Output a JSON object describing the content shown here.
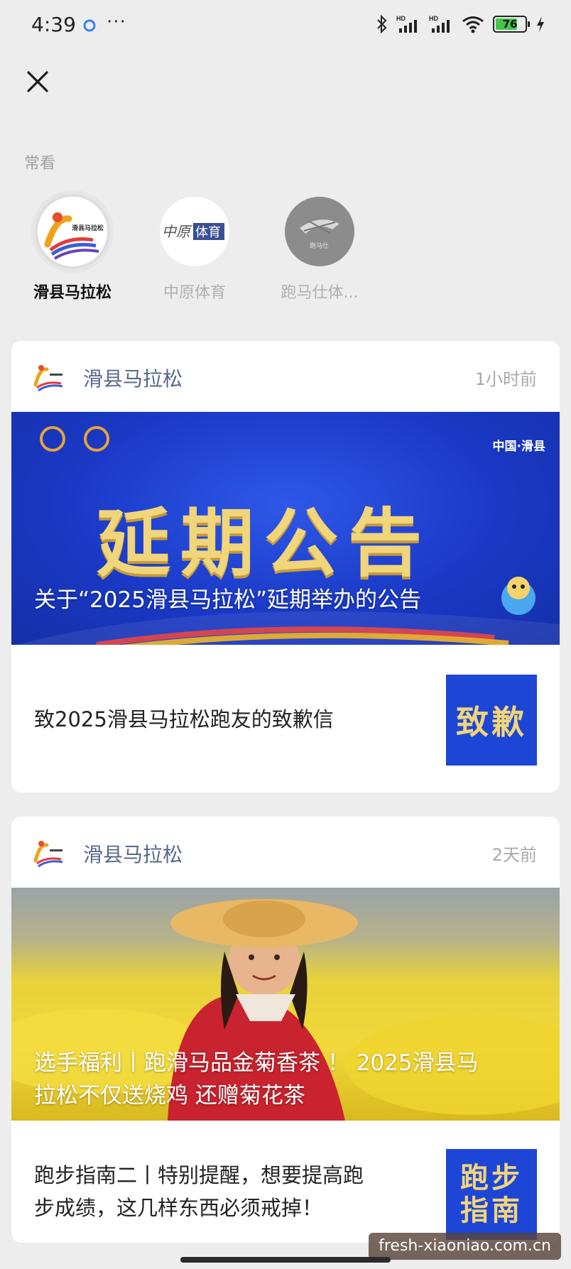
{
  "status_bar": {
    "time": "4:39",
    "dots": "···",
    "battery": "76",
    "battery_level": 0.76
  },
  "section_label": "常看",
  "frequent": [
    {
      "name": "滑县马拉松"
    },
    {
      "name": "中原体育"
    },
    {
      "name": "跑马仕体..."
    }
  ],
  "logos": {
    "huaxian_text": "滑县马拉松",
    "zhongyuan_a": "中原",
    "zhongyuan_b": "体育",
    "paomashi_text": "跑马仕"
  },
  "cards": [
    {
      "account": "滑县马拉松",
      "time": "1小时前",
      "hero_place": "中国·滑县",
      "hero_big": "延期公告",
      "hero_caption": "关于“2025滑县马拉松”延期举办的公告",
      "sub_title": "致2025滑县马拉松跑友的致歉信",
      "thumb_text": "致歉"
    },
    {
      "account": "滑县马拉松",
      "time": "2天前",
      "hero_caption_line1": "选手福利丨跑滑马品金菊香茶 ！ 2025滑县马",
      "hero_caption_line2": "拉松不仅送烧鸡 还赠菊花茶",
      "sub_title_line1": "跑步指南二丨特别提醒，想要提高跑",
      "sub_title_line2": "步成绩，这几样东西必须戒掉！",
      "thumb_line1": "跑步",
      "thumb_line2": "指南"
    }
  ],
  "watermark": "fresh-xiaoniao.com.cn",
  "colors": {
    "page_bg": "#ededed",
    "blue_banner": "#1d3fc8",
    "gold_text": "#f0d57a",
    "account_name": "#56688a"
  }
}
